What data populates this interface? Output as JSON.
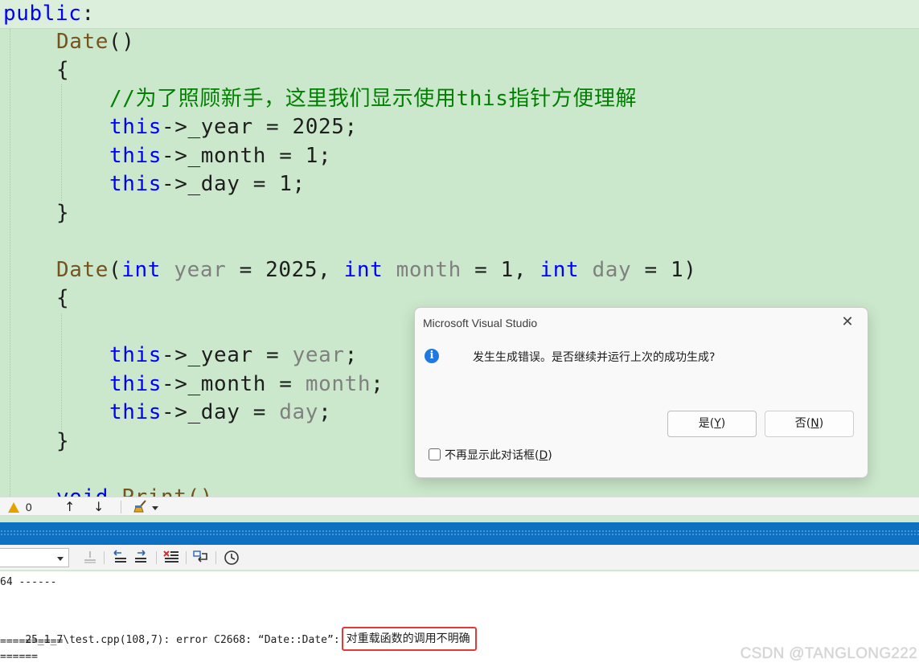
{
  "editor": {
    "lines": {
      "l1_kw": "public",
      "l1_colon": ":",
      "ctor1_name": "Date",
      "ctor1_parens": "()",
      "brace_open": "{",
      "brace_close": "}",
      "comment": "//为了照顾新手，这里我们显示使用this指针方便理解",
      "this_kw": "this",
      "assign_year_a": "->_year = 2025;",
      "assign_month_a": "->_month = 1;",
      "assign_day_a": "->_day = 1;",
      "ctor2_name": "Date",
      "ctor2_open": "(",
      "int_kw": "int",
      "p_year": "year",
      "def_year": " = 2025, ",
      "p_month": "month",
      "def_month": " = 1, ",
      "p_day": "day",
      "def_day": " = 1)",
      "assign_year_b_pre": "->_year = ",
      "assign_month_b_pre": "->_month = ",
      "assign_day_b_pre": "->_day = ",
      "semicolon": ";",
      "partial_void": "void",
      "partial_print": "Print()"
    }
  },
  "status_strip": {
    "warning_count": "0",
    "up_arrow": "↑",
    "down_arrow": "↓"
  },
  "output": {
    "line1": "64 ------",
    "line2_prefix": "25_1_7\\test.cpp(108,7): error C2668: “Date::Date”:",
    "line2_highlight": "对重载函数的调用不明确",
    "line3": "==========",
    "line4": "======"
  },
  "watermark": "CSDN @TANGLONG222",
  "dialog": {
    "title": "Microsoft Visual Studio",
    "close_glyph": "✕",
    "info_glyph": "i",
    "message": "发生生成错误。是否继续并运行上次的成功生成?",
    "yes_text": "是(",
    "yes_key": "Y",
    "no_text": "否(",
    "no_key": "N",
    "paren_close": ")",
    "checkbox_text": "不再显示此对话框(",
    "checkbox_key": "D"
  }
}
